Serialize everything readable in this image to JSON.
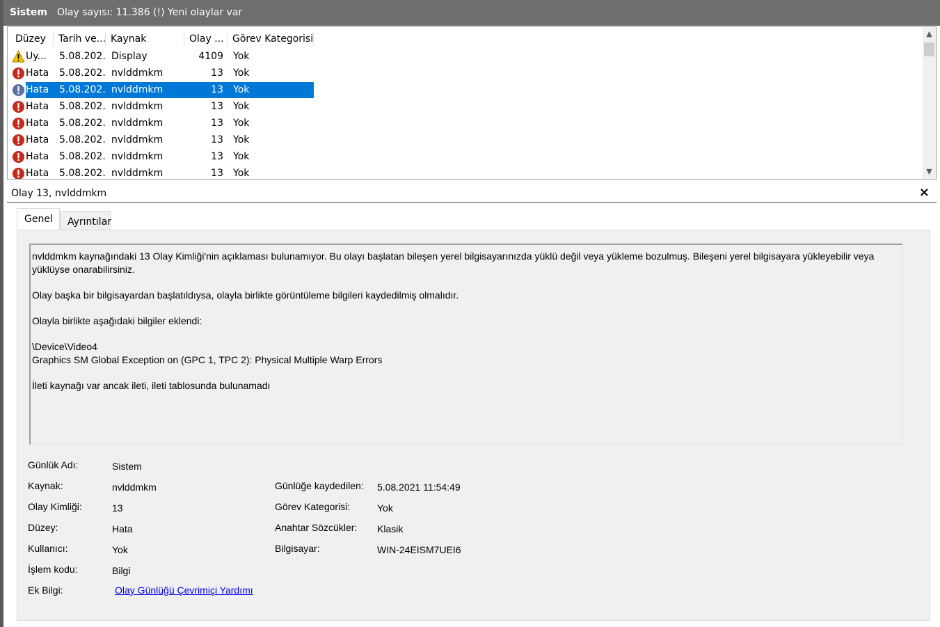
{
  "topbar": {
    "log_name": "Sistem",
    "count_text": "Olay sayısı: 11.386 (!) Yeni olaylar var"
  },
  "columns": [
    "Düzey",
    "Tarih ve...",
    "Kaynak",
    "Olay ...",
    "Görev Kategorisi"
  ],
  "rows": [
    {
      "icon": "warning-icon",
      "level": "Uy...",
      "date": "5.08.202...",
      "source": "Display",
      "id": "4109",
      "category": "Yok",
      "selected": false
    },
    {
      "icon": "error-icon",
      "level": "Hata",
      "date": "5.08.202...",
      "source": "nvlddmkm",
      "id": "13",
      "category": "Yok",
      "selected": false
    },
    {
      "icon": "error-icon",
      "level": "Hata",
      "date": "5.08.202...",
      "source": "nvlddmkm",
      "id": "13",
      "category": "Yok",
      "selected": true
    },
    {
      "icon": "error-icon",
      "level": "Hata",
      "date": "5.08.202...",
      "source": "nvlddmkm",
      "id": "13",
      "category": "Yok",
      "selected": false
    },
    {
      "icon": "error-icon",
      "level": "Hata",
      "date": "5.08.202...",
      "source": "nvlddmkm",
      "id": "13",
      "category": "Yok",
      "selected": false
    },
    {
      "icon": "error-icon",
      "level": "Hata",
      "date": "5.08.202...",
      "source": "nvlddmkm",
      "id": "13",
      "category": "Yok",
      "selected": false
    },
    {
      "icon": "error-icon",
      "level": "Hata",
      "date": "5.08.202...",
      "source": "nvlddmkm",
      "id": "13",
      "category": "Yok",
      "selected": false
    },
    {
      "icon": "error-icon",
      "level": "Hata",
      "date": "5.08.202...",
      "source": "nvlddmkm",
      "id": "13",
      "category": "Yok",
      "selected": false
    }
  ],
  "detail": {
    "title": "Olay 13, nvlddmkm",
    "close_glyph": "×",
    "tabs": [
      "Genel",
      "Ayrıntılar"
    ],
    "message": {
      "p1": "nvlddmkm kaynağındaki 13 Olay Kimliği'nin açıklaması bulunamıyor. Bu olayı başlatan bileşen yerel bilgisayarınızda yüklü değil veya yükleme bozulmuş. Bileşeni yerel bilgisayara yükleyebilir veya yüklüyse onarabilirsiniz.",
      "p2": "Olay başka bir bilgisayardan başlatıldıysa, olayla birlikte görüntüleme bilgileri kaydedilmiş olmalıdır.",
      "p3": "Olayla birlikte aşağıdaki bilgiler eklendi:",
      "p4a": "\\Device\\Video4",
      "p4b": "Graphics SM Global Exception on (GPC 1, TPC 2): Physical Multiple Warp Errors",
      "p5": "İleti kaynağı var ancak ileti, ileti tablosunda bulunamadı"
    },
    "props": {
      "log_name_label": "Günlük Adı:",
      "log_name": "Sistem",
      "source_label": "Kaynak:",
      "source": "nvlddmkm",
      "event_id_label": "Olay Kimliği:",
      "event_id": "13",
      "level_label": "Düzey:",
      "level": "Hata",
      "user_label": "Kullanıcı:",
      "user": "Yok",
      "opcode_label": "İşlem kodu:",
      "opcode": "Bilgi",
      "more_info_label": "Ek Bilgi:",
      "more_info_link": "Olay Günlüğü Çevrimiçi Yardımı",
      "logged_label": "Günlüğe kaydedilen:",
      "logged": "5.08.2021 11:54:49",
      "task_label": "Görev Kategorisi:",
      "task": "Yok",
      "keywords_label": "Anahtar Sözcükler:",
      "keywords": "Klasik",
      "computer_label": "Bilgisayar:",
      "computer": "WIN-24EISM7UEI6"
    }
  },
  "colors": {
    "selection": "#0078d7",
    "topbar": "#6e6e6e",
    "error": "#c42b1c",
    "warning": "#f2c500",
    "link": "#0000ee"
  }
}
